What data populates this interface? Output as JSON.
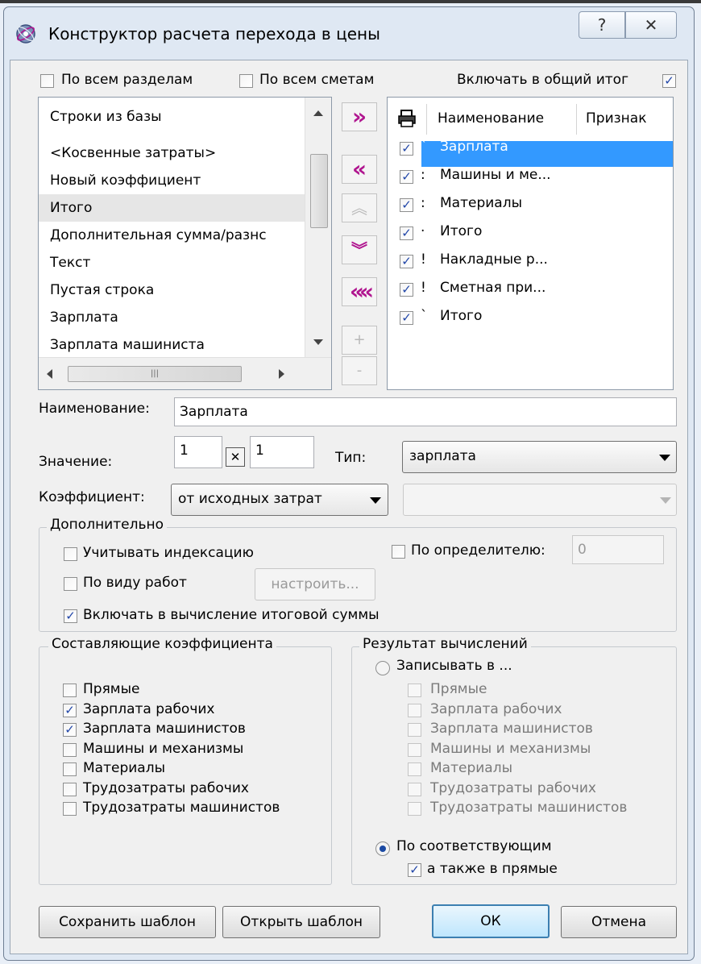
{
  "window": {
    "title": "Конструктор расчета перехода в цены",
    "help_btn": "?",
    "close_btn": "✕"
  },
  "top_options": {
    "all_sections": {
      "label": "По всем разделам",
      "checked": false
    },
    "all_estimates": {
      "label": "По всем сметам",
      "checked": false
    },
    "include_total": {
      "label": "Включать в общий итог",
      "checked": true
    }
  },
  "source_list": {
    "header": "Строки из базы",
    "items": [
      "<Косвенные затраты>",
      "Новый коэффициент",
      "Итого",
      "Дополнительная сумма/разнс",
      "Текст",
      "Пустая строка",
      "Зарплата",
      "Зарплата машиниста"
    ],
    "selected_index": 2
  },
  "move_buttons": {
    "add": "»",
    "remove": "«",
    "up": "︽",
    "down": "︾",
    "remove_all": "«",
    "plus": "+",
    "minus": "-"
  },
  "target_list": {
    "columns": [
      "Наименование",
      "Признак"
    ],
    "rows": [
      {
        "mark": "`",
        "name": "Зарплата",
        "checked": true,
        "selected": true
      },
      {
        "mark": ":",
        "name": "Машины и ме...",
        "checked": true
      },
      {
        "mark": ":",
        "name": "Материалы",
        "checked": true
      },
      {
        "mark": "·",
        "name": "Итого",
        "checked": true
      },
      {
        "mark": "!",
        "name": "Накладные р...",
        "checked": true
      },
      {
        "mark": "!",
        "name": "Сметная при...",
        "checked": true
      },
      {
        "mark": "`",
        "name": "Итого",
        "checked": true
      }
    ]
  },
  "name_row": {
    "label": "Наименование:",
    "value": "Зарплата"
  },
  "value_row": {
    "label": "Значение:",
    "value1": "1",
    "times": "✕",
    "value2": "1",
    "type_label": "Тип:",
    "type_value": "зарплата"
  },
  "coef_row": {
    "label": "Коэффициент:",
    "value": "от исходных затрат",
    "second_value": ""
  },
  "extra": {
    "title": "Дополнительно",
    "indexing": {
      "label": "Учитывать индексацию",
      "checked": false
    },
    "by_determinant": {
      "label": "По определителю:",
      "checked": false,
      "value": "0"
    },
    "by_work_type": {
      "label": "По виду работ",
      "checked": false
    },
    "configure": "настроить...",
    "include_total_sum": {
      "label": "Включать в вычисление итоговой суммы",
      "checked": true
    }
  },
  "components": {
    "title": "Составляющие коэффициента",
    "items": [
      {
        "label": "Прямые",
        "checked": false
      },
      {
        "label": "Зарплата рабочих",
        "checked": true
      },
      {
        "label": "Зарплата машинистов",
        "checked": true
      },
      {
        "label": "Машины и механизмы",
        "checked": false
      },
      {
        "label": "Материалы",
        "checked": false
      },
      {
        "label": "Трудозатраты рабочих",
        "checked": false
      },
      {
        "label": "Трудозатраты машинистов",
        "checked": false
      }
    ]
  },
  "result": {
    "title": "Результат вычислений",
    "write_to": {
      "label": "Записывать в ...",
      "selected": false
    },
    "write_items": [
      "Прямые",
      "Зарплата рабочих",
      "Зарплата машинистов",
      "Машины и механизмы",
      "Материалы",
      "Трудозатраты рабочих",
      "Трудозатраты машинистов"
    ],
    "by_corresponding": {
      "label": "По соответствующим",
      "selected": true
    },
    "also_direct": {
      "label": "а также в прямые",
      "checked": true
    }
  },
  "buttons": {
    "save_template": "Сохранить шаблон",
    "open_template": "Открыть шаблон",
    "ok": "ОК",
    "cancel": "Отмена"
  },
  "colors": {
    "accent_magenta": "#b0158f",
    "selection_blue": "#3399ff",
    "check_blue": "#2146a8"
  }
}
